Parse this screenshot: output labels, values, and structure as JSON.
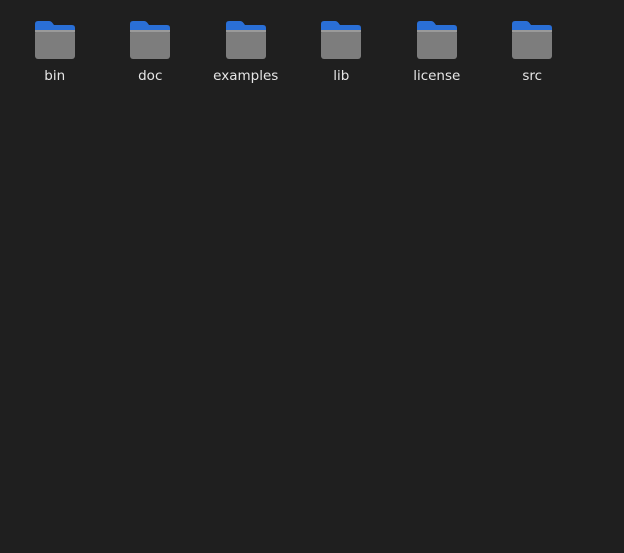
{
  "folders": [
    {
      "label": "bin",
      "icon": "folder-icon"
    },
    {
      "label": "doc",
      "icon": "folder-icon"
    },
    {
      "label": "examples",
      "icon": "folder-icon"
    },
    {
      "label": "lib",
      "icon": "folder-icon"
    },
    {
      "label": "license",
      "icon": "folder-icon"
    },
    {
      "label": "src",
      "icon": "folder-icon"
    }
  ],
  "colors": {
    "background": "#1f1f1f",
    "folder_tab": "#2a6fd6",
    "folder_body": "#7d7d7d",
    "label_text": "#e6e6e6"
  }
}
